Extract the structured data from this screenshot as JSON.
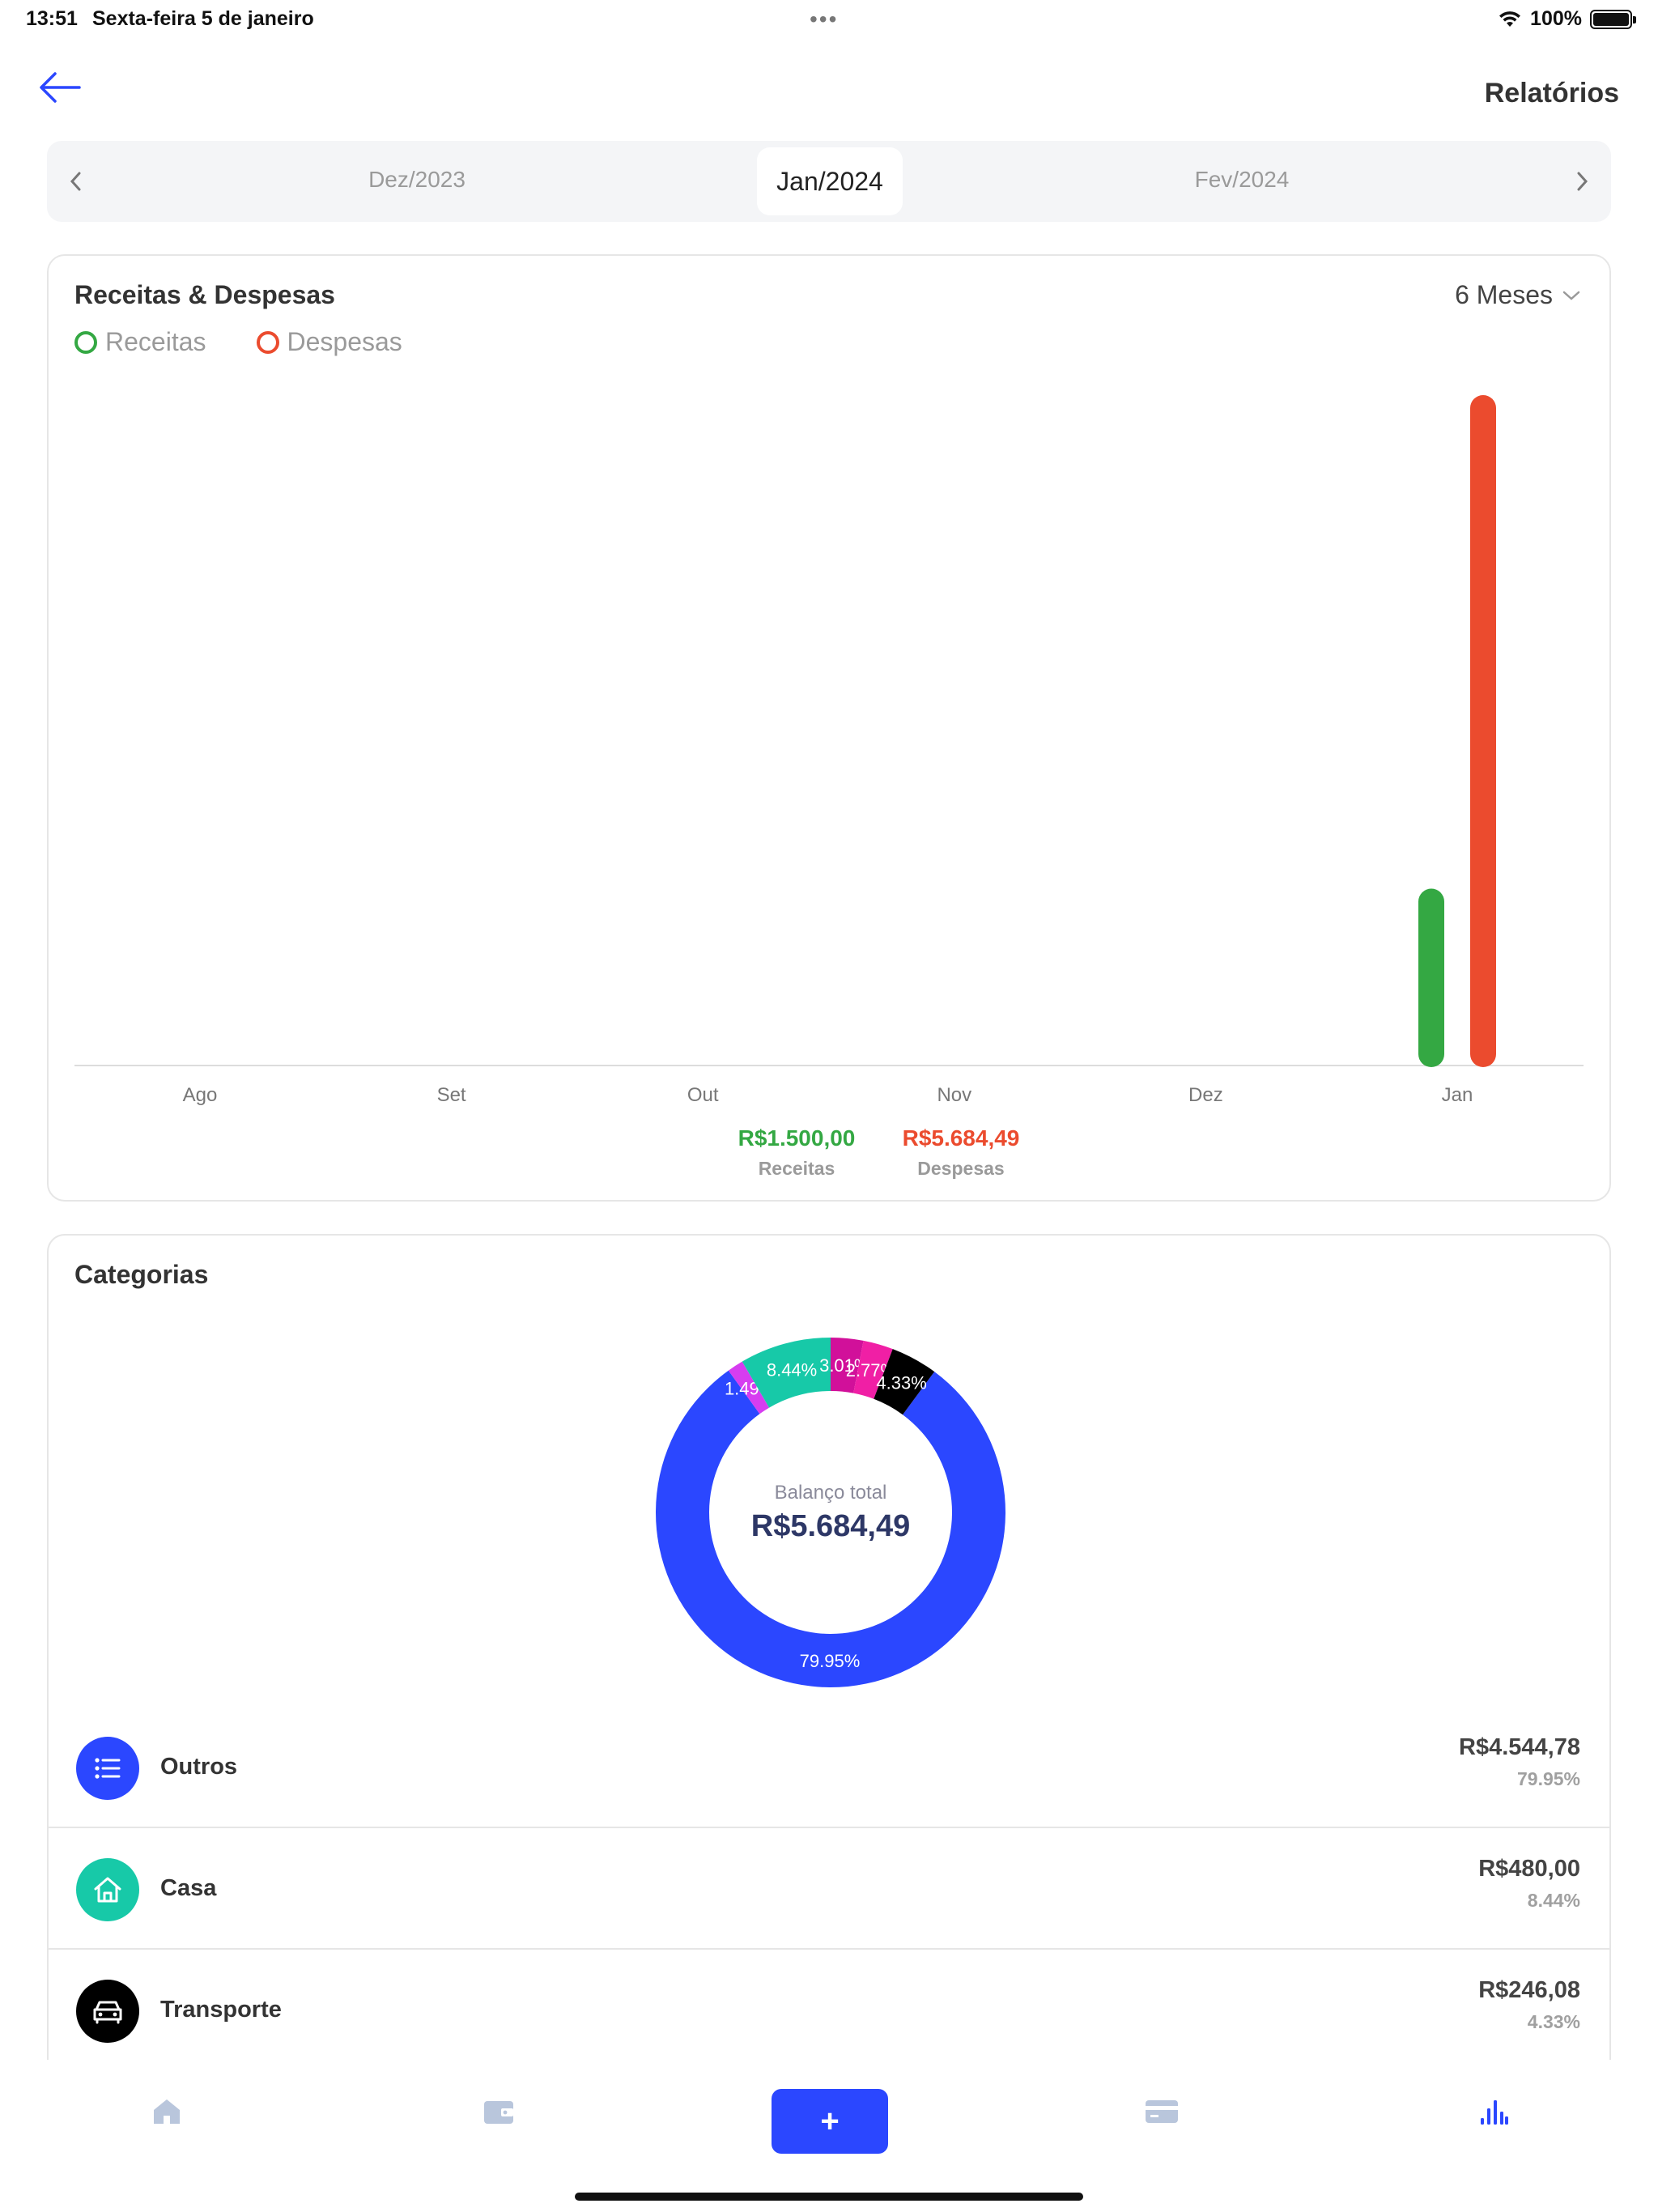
{
  "status": {
    "time": "13:51",
    "date": "Sexta-feira 5 de janeiro",
    "dots": "•••",
    "battery": "100%"
  },
  "header": {
    "title": "Relatórios"
  },
  "month_selector": {
    "previous": "Dez/2023",
    "current": "Jan/2024",
    "next": "Fev/2024"
  },
  "income_expense_card": {
    "title": "Receitas & Despesas",
    "period": "6 Meses",
    "legend_income": "Receitas",
    "legend_expense": "Despesas",
    "income_total": "R$1.500,00",
    "income_label": "Receitas",
    "expense_total": "R$5.684,49",
    "expense_label": "Despesas"
  },
  "categories_card": {
    "title": "Categorias",
    "center_label": "Balanço total",
    "center_value": "R$5.684,49",
    "items": [
      {
        "name": "Outros",
        "amount": "R$4.544,78",
        "percent": "79.95%",
        "icon": "list-icon",
        "color": "#2b47ff"
      },
      {
        "name": "Casa",
        "amount": "R$480,00",
        "percent": "8.44%",
        "icon": "house-icon",
        "color": "#17c9a8"
      },
      {
        "name": "Transporte",
        "amount": "R$246,08",
        "percent": "4.33%",
        "icon": "car-icon",
        "color": "#000000"
      }
    ]
  },
  "chart_data": [
    {
      "type": "bar",
      "categories": [
        "Ago",
        "Set",
        "Out",
        "Nov",
        "Dez",
        "Jan"
      ],
      "series": [
        {
          "name": "Receitas",
          "color": "#34a843",
          "values": [
            0,
            0,
            0,
            0,
            0,
            1500.0
          ]
        },
        {
          "name": "Despesas",
          "color": "#eb4b2e",
          "values": [
            0,
            0,
            0,
            0,
            0,
            5684.49
          ]
        }
      ],
      "title": "Receitas & Despesas",
      "ylim": [
        0,
        5684.49
      ],
      "grid": false,
      "legend": "top-left"
    },
    {
      "type": "pie",
      "labels": [
        "Outros",
        "Casa",
        "Transporte",
        "",
        "",
        ""
      ],
      "values": [
        79.95,
        8.44,
        4.33,
        2.77,
        3.01,
        1.49
      ],
      "display_labels": [
        "79.95%",
        "8.44%",
        "4.33%",
        "2.77%",
        "3.01%",
        "1.49%"
      ],
      "colors": [
        "#2b47ff",
        "#17c9a8",
        "#000000",
        "#f01fa5",
        "#d1109a",
        "#d63df0"
      ],
      "donut": true
    }
  ],
  "tabs": [
    {
      "name": "tab-home",
      "icon": "home-icon"
    },
    {
      "name": "tab-wallet",
      "icon": "wallet-icon"
    },
    {
      "name": "tab-add",
      "label": "+"
    },
    {
      "name": "tab-cards",
      "icon": "card-icon"
    },
    {
      "name": "tab-reports",
      "icon": "bar-chart-icon"
    }
  ],
  "colors": {
    "accent": "#2b47ff",
    "income": "#34a843",
    "expense": "#eb4b2e",
    "tab_inactive": "#b9c6dc"
  }
}
